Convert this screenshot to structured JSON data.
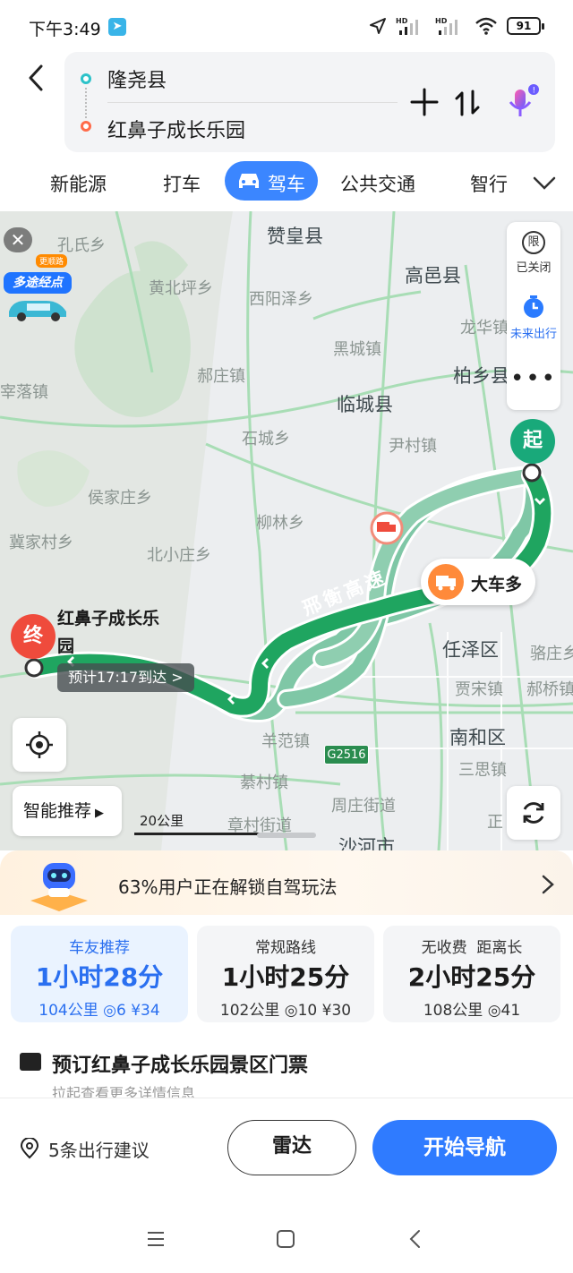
{
  "status_bar": {
    "time": "下午3:49",
    "battery": "91"
  },
  "route": {
    "origin": "隆尧县",
    "destination": "红鼻子成长乐园"
  },
  "modes": [
    {
      "label": "新能源"
    },
    {
      "label": "打车"
    },
    {
      "label": "驾车",
      "active": true
    },
    {
      "label": "公共交通"
    },
    {
      "label": "智行"
    }
  ],
  "map": {
    "side_panel": {
      "restrict_icon": "限",
      "restrict_label": "已关闭",
      "future_label": "未来出行"
    },
    "multi_stop": {
      "badge": "多途经点",
      "tag": "更顺路"
    },
    "start_marker": "起",
    "end_marker": "终",
    "destination_label": "红鼻子成长乐园",
    "eta": "预计17:17到达 >",
    "truck_tip": "大车多",
    "highway": "邢衡高速",
    "road_shield": "G2516",
    "smart_button": "智能推荐",
    "scale": "20公里",
    "places": [
      {
        "name": "赞皇县",
        "cls": "big"
      },
      {
        "name": "孔氏乡",
        "cls": ""
      },
      {
        "name": "黄北坪乡",
        "cls": ""
      },
      {
        "name": "西阳泽乡",
        "cls": ""
      },
      {
        "name": "高邑县",
        "cls": "big"
      },
      {
        "name": "龙华镇",
        "cls": ""
      },
      {
        "name": "黑城镇",
        "cls": ""
      },
      {
        "name": "郝庄镇",
        "cls": ""
      },
      {
        "name": "柏乡县",
        "cls": "big"
      },
      {
        "name": "宰落镇",
        "cls": ""
      },
      {
        "name": "临城县",
        "cls": "big"
      },
      {
        "name": "石城乡",
        "cls": ""
      },
      {
        "name": "尹村镇",
        "cls": ""
      },
      {
        "name": "侯家庄乡",
        "cls": ""
      },
      {
        "name": "柳林乡",
        "cls": ""
      },
      {
        "name": "冀家村乡",
        "cls": ""
      },
      {
        "name": "北小庄乡",
        "cls": ""
      },
      {
        "name": "任泽区",
        "cls": "big"
      },
      {
        "name": "骆庄乡",
        "cls": ""
      },
      {
        "name": "贾宋镇",
        "cls": ""
      },
      {
        "name": "郝桥镇",
        "cls": ""
      },
      {
        "name": "羊范镇",
        "cls": ""
      },
      {
        "name": "南和区",
        "cls": "big"
      },
      {
        "name": "三思镇",
        "cls": ""
      },
      {
        "name": "綦村镇",
        "cls": ""
      },
      {
        "name": "周庄街道",
        "cls": ""
      },
      {
        "name": "章村街道",
        "cls": ""
      },
      {
        "name": "沙河市",
        "cls": "big"
      },
      {
        "name": "正",
        "cls": ""
      }
    ]
  },
  "promo": {
    "text": "63%用户正在解锁自驾玩法"
  },
  "route_options": [
    {
      "tag": "车友推荐",
      "duration": "1小时28分",
      "distance": "104公里",
      "lights": "6",
      "toll": "¥34"
    },
    {
      "tag": "常规路线",
      "duration": "1小时25分",
      "distance": "102公里",
      "lights": "10",
      "toll": "¥30"
    },
    {
      "tag": "无收费  距离长",
      "duration": "2小时25分",
      "distance": "108公里",
      "lights": "41",
      "toll": ""
    }
  ],
  "ticket": {
    "title": "预订红鼻子成长乐园景区门票",
    "subtitle": "拉起查看更多详情信息"
  },
  "actions": {
    "tips": "5条出行建议",
    "radar": "雷达",
    "navigate": "开始导航"
  },
  "colors": {
    "accent": "#2f7bff",
    "route_green": "#1fa560",
    "alt_route": "#7fc7a6",
    "start": "#19a97a",
    "end": "#ef4b3c"
  }
}
